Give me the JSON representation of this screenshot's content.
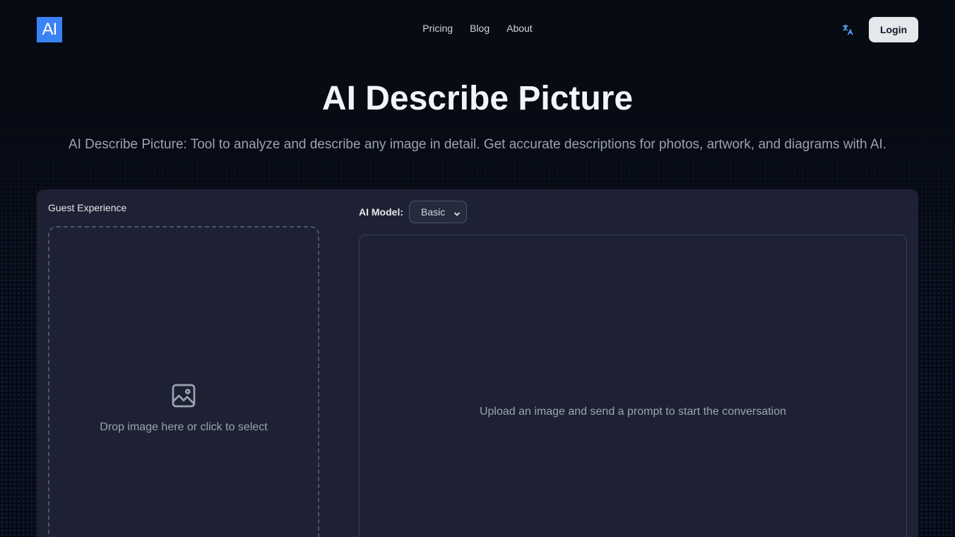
{
  "header": {
    "logo_text": "AI",
    "nav": [
      {
        "label": "Pricing"
      },
      {
        "label": "Blog"
      },
      {
        "label": "About"
      }
    ],
    "translate_icon": "translate-icon",
    "login_label": "Login"
  },
  "hero": {
    "title": "AI Describe Picture",
    "subtitle": "AI Describe Picture: Tool to analyze and describe any image in detail. Get accurate descriptions for photos, artwork, and diagrams with AI."
  },
  "upload": {
    "label": "Guest Experience",
    "icon": "image-icon",
    "dropzone_text": "Drop image here or click to select"
  },
  "model": {
    "label": "AI Model:",
    "selected": "Basic"
  },
  "chat": {
    "placeholder": "Upload an image and send a prompt to start the conversation"
  },
  "colors": {
    "accent": "#3b82f6",
    "panel": "#1e2133",
    "background": "#070b14"
  }
}
